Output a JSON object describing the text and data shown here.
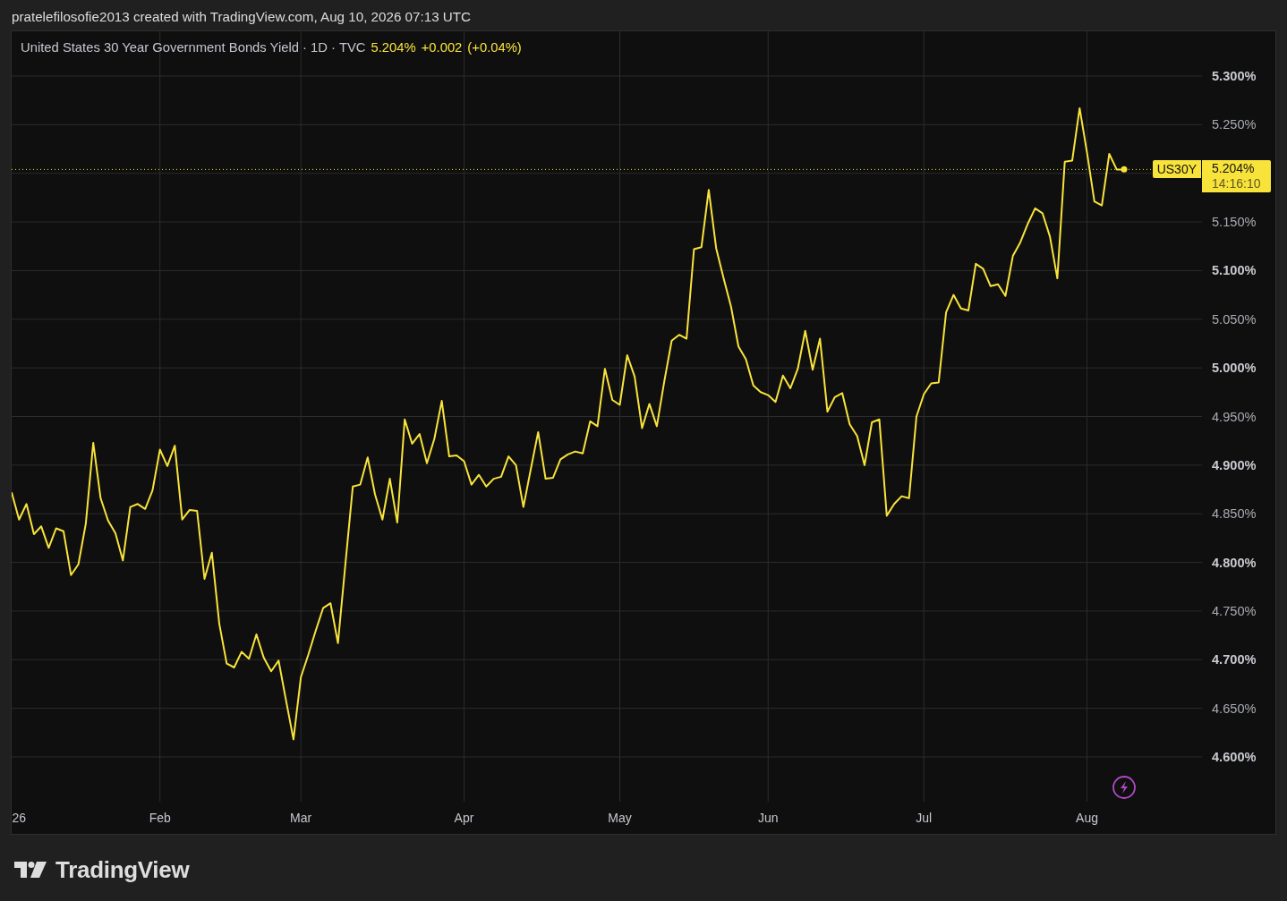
{
  "caption": "pratelefilosofie2013 created with TradingView.com, Aug 10, 2026 07:13 UTC",
  "chart": {
    "legend": {
      "title": "United States 30 Year Government Bonds Yield · 1D · TVC",
      "last": "5.204%",
      "change": "+0.002",
      "change_pct": "(+0.04%)"
    },
    "price_tag": {
      "value": "5.204%",
      "countdown": "14:16:10"
    },
    "chart_data": {
      "type": "line",
      "grid": true,
      "categories": [
        null,
        "26",
        null,
        null,
        null,
        null,
        null,
        null,
        null,
        null,
        null,
        null,
        null,
        null,
        null,
        null,
        null,
        null,
        null,
        null,
        "Feb",
        null,
        null,
        null,
        null,
        null,
        null,
        null,
        null,
        null,
        null,
        null,
        null,
        null,
        null,
        null,
        null,
        null,
        null,
        "Mar",
        null,
        null,
        null,
        null,
        null,
        null,
        null,
        null,
        null,
        null,
        null,
        null,
        null,
        null,
        null,
        null,
        null,
        null,
        null,
        null,
        null,
        "Apr",
        null,
        null,
        null,
        null,
        null,
        null,
        null,
        null,
        null,
        null,
        null,
        null,
        null,
        null,
        null,
        null,
        null,
        null,
        null,
        null,
        "May",
        null,
        null,
        null,
        null,
        null,
        null,
        null,
        null,
        null,
        null,
        null,
        null,
        null,
        null,
        null,
        null,
        null,
        null,
        null,
        "Jun",
        null,
        null,
        null,
        null,
        null,
        null,
        null,
        null,
        null,
        null,
        null,
        null,
        null,
        null,
        null,
        null,
        null,
        null,
        null,
        null,
        "Jul",
        null,
        null,
        null,
        null,
        null,
        null,
        null,
        null,
        null,
        null,
        null,
        null,
        null,
        null,
        null,
        null,
        null,
        null,
        null,
        null,
        null,
        "Aug",
        null,
        null,
        null,
        null,
        null,
        null,
        null,
        null,
        null,
        null,
        null,
        null,
        null,
        null,
        null
      ],
      "series": [
        {
          "name": "US30Y",
          "color": "#f8e33b",
          "values": [
            4.872,
            4.844,
            4.86,
            4.829,
            4.837,
            4.815,
            4.835,
            4.832,
            4.787,
            4.798,
            4.84,
            4.923,
            4.866,
            4.843,
            4.83,
            4.802,
            4.857,
            4.86,
            4.855,
            4.874,
            4.916,
            4.899,
            4.92,
            4.844,
            4.854,
            4.853,
            4.783,
            4.81,
            4.737,
            4.696,
            4.692,
            4.708,
            4.701,
            4.726,
            4.702,
            4.688,
            4.699,
            4.658,
            4.618,
            4.682,
            4.705,
            4.73,
            4.753,
            4.758,
            4.717,
            4.798,
            4.878,
            4.88,
            4.908,
            4.87,
            4.844,
            4.886,
            4.841,
            4.947,
            4.922,
            4.932,
            4.902,
            4.927,
            4.966,
            4.909,
            4.91,
            4.904,
            4.88,
            4.89,
            4.878,
            4.886,
            4.888,
            4.909,
            4.9,
            4.857,
            4.896,
            4.934,
            4.886,
            4.887,
            4.906,
            4.911,
            4.914,
            4.912,
            4.945,
            4.94,
            4.999,
            4.967,
            4.962,
            5.013,
            4.991,
            4.938,
            4.963,
            4.94,
            4.986,
            5.028,
            5.034,
            5.03,
            5.122,
            5.124,
            5.183,
            5.123,
            5.092,
            5.063,
            5.022,
            5.009,
            4.982,
            4.975,
            4.972,
            4.965,
            4.992,
            4.979,
            4.999,
            5.038,
            4.998,
            5.03,
            4.955,
            4.97,
            4.974,
            4.942,
            4.93,
            4.9,
            4.944,
            4.947,
            4.848,
            4.86,
            4.868,
            4.866,
            4.95,
            4.973,
            4.984,
            4.985,
            5.057,
            5.075,
            5.061,
            5.059,
            5.107,
            5.102,
            5.084,
            5.086,
            5.074,
            5.115,
            5.129,
            5.148,
            5.164,
            5.159,
            5.135,
            5.092,
            5.212,
            5.213,
            5.267,
            5.221,
            5.171,
            5.167,
            5.22,
            5.204,
            5.204,
            null,
            null,
            null,
            null,
            null,
            null,
            null,
            null,
            null,
            null
          ]
        }
      ],
      "ylim": [
        4.554,
        5.346
      ],
      "yticks": [
        {
          "value": 4.6,
          "label": "4.600%"
        },
        {
          "value": 4.65,
          "label": "4.650%"
        },
        {
          "value": 4.7,
          "label": "4.700%"
        },
        {
          "value": 4.75,
          "label": "4.750%"
        },
        {
          "value": 4.8,
          "label": "4.800%"
        },
        {
          "value": 4.85,
          "label": "4.850%"
        },
        {
          "value": 4.9,
          "label": "4.900%"
        },
        {
          "value": 4.95,
          "label": "4.950%"
        },
        {
          "value": 5.0,
          "label": "5.000%"
        },
        {
          "value": 5.05,
          "label": "5.050%"
        },
        {
          "value": 5.1,
          "label": "5.100%"
        },
        {
          "value": 5.15,
          "label": "5.150%"
        },
        {
          "value": 5.25,
          "label": "5.250%"
        },
        {
          "value": 5.3,
          "label": "5.300%"
        }
      ],
      "ref_lines": [
        {
          "axis": "y",
          "value": 5.204
        }
      ]
    }
  },
  "logo": {
    "text": "TradingView"
  }
}
